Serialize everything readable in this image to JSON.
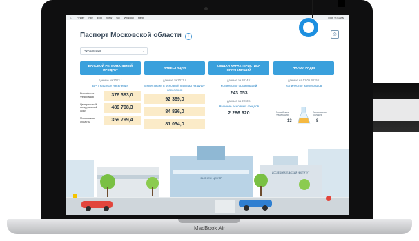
{
  "menubar": {
    "items": [
      "Finder",
      "File",
      "Edit",
      "View",
      "Go",
      "Window",
      "Help"
    ],
    "clock": "Mon 9:41 AM"
  },
  "page": {
    "title": "Паспорт Московской области",
    "dropdown_value": "Экономика"
  },
  "columns": [
    {
      "header": "ВАЛОВОЙ РЕГИОНАЛЬНЫЙ ПРОДУКТ",
      "note": "данные за 2013 г.",
      "link": "ВРП на душу населения",
      "rows": [
        {
          "label": "Российская Федерация",
          "value": "376 383,0"
        },
        {
          "label": "Центральный федеральный округ",
          "value": "489 708,3"
        },
        {
          "label": "Московская область",
          "value": "359 799,4"
        }
      ]
    },
    {
      "header": "ИНВЕСТИЦИИ",
      "note": "данные за 2013 г.",
      "link": "Инвестиции в основной капитал на душу населения",
      "values": [
        "92 369,0",
        "84 836,0",
        "81 034,0"
      ]
    },
    {
      "header": "ОБЩАЯ ХАРАКТЕРИСТИКА ОРГАНИЗАЦИЙ",
      "note": "данные за 2014 г.",
      "link": "Количество организаций",
      "value1": "243 053",
      "note2": "данные за 2013 г.",
      "link2": "Наличие основных фондов",
      "value2": "2 286 920"
    },
    {
      "header": "НАУКОГРАДЫ",
      "note": "данные на 01.05.2015 г.",
      "link": "Количество наукоградов",
      "flask_left_label": "Российская Федерация",
      "flask_left_value": "13",
      "flask_right_label": "Московская область",
      "flask_right_value": "8",
      "flask_percent": "61%"
    }
  ],
  "city": {
    "building_sign": "БИЗНЕС ЦЕНТР",
    "institute_sign": "ИССЛЕДОВАТЕЛЬСКИЙ ИНСТИТУТ"
  },
  "laptop_brand": "MacBook Air",
  "colors": {
    "header_blue": "#3aa0dc",
    "value_highlight": "#fbebc8",
    "marker_blue": "#1d8fe0"
  }
}
